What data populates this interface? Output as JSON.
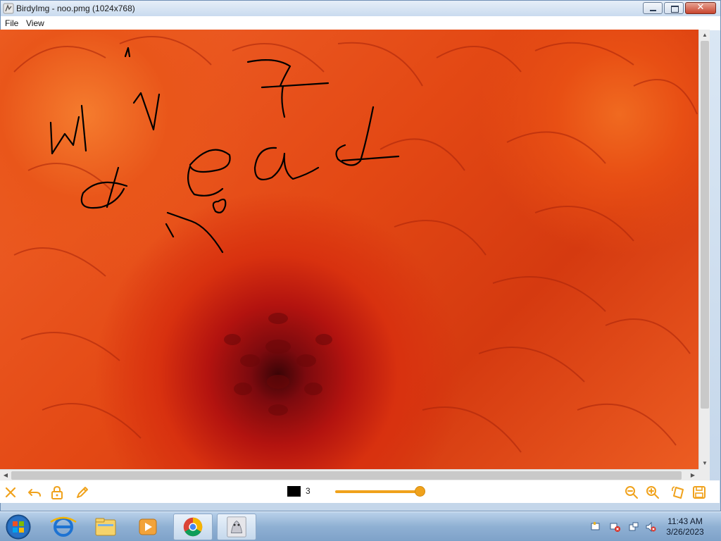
{
  "window": {
    "title": "BirdyImg - noo.pmg (1024x768)"
  },
  "menu": {
    "items": [
      {
        "label": "File"
      },
      {
        "label": "View"
      }
    ]
  },
  "canvas": {
    "handwriting": "WIN 7 dead n"
  },
  "toolbar": {
    "tools": [
      "close-icon",
      "undo-icon",
      "lock-icon",
      "pencil-icon"
    ],
    "pen_color": "#000000",
    "pen_size": "3",
    "pen_slider_fraction": 1.0,
    "accent": "#f0a21c",
    "right_tools": [
      "zoom-out-icon",
      "zoom-in-icon",
      "rotate-icon",
      "save-icon"
    ]
  },
  "taskbar": {
    "apps": [
      "internet-explorer-icon",
      "file-explorer-icon",
      "media-player-icon",
      "chrome-icon",
      "birdyimg-icon"
    ],
    "clock_time": "11:43 AM",
    "clock_date": "3/26/2023"
  }
}
